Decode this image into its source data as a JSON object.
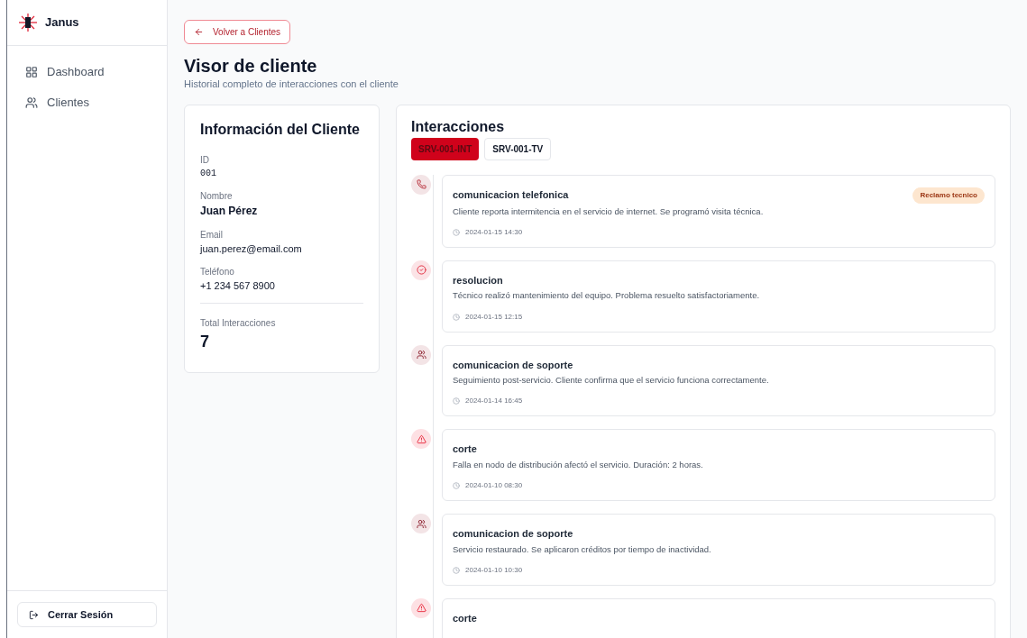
{
  "sidebar": {
    "brand": "Janus",
    "items": [
      {
        "label": "Dashboard",
        "kind": "grid",
        "selected": false
      },
      {
        "label": "Clientes",
        "kind": "users",
        "selected": false
      }
    ],
    "logout": "Cerrar Sesión"
  },
  "header": {
    "back": "Volver a Clientes",
    "title": "Visor de cliente",
    "subtitle": "Historial completo de interacciones con el cliente"
  },
  "client": {
    "title": "Información del Cliente",
    "fields": [
      {
        "label": "ID",
        "value": "001",
        "kind": "mono"
      },
      {
        "label": "Nombre",
        "value": "Juan Pérez",
        "kind": "strong"
      },
      {
        "label": "Email",
        "value": "juan.perez@email.com",
        "kind": "plain"
      },
      {
        "label": "Teléfono",
        "value": "+1 234 567 8900",
        "kind": "plain"
      }
    ],
    "total_label": "Total Interacciones",
    "total": "7"
  },
  "interactions": {
    "title": "Interacciones",
    "tabs": [
      {
        "label": "SRV-001-INT",
        "selected": true
      },
      {
        "label": "SRV-001-TV",
        "selected": false
      }
    ],
    "items": [
      {
        "kind": "phone",
        "title": "comunicacion telefonica",
        "badge": "Reclamo tecnico",
        "text": "Cliente reporta intermitencia en el servicio de internet. Se programó visita técnica.",
        "time": "2024-01-15 14:30"
      },
      {
        "kind": "check",
        "title": "resolucion",
        "text": "Técnico realizó mantenimiento del equipo. Problema resuelto satisfactoriamente.",
        "time": "2024-01-15 12:15"
      },
      {
        "kind": "users",
        "title": "comunicacion de soporte",
        "text": "Seguimiento post-servicio. Cliente confirma que el servicio funciona correctamente.",
        "time": "2024-01-14 16:45"
      },
      {
        "kind": "alert",
        "title": "corte",
        "text": "Falla en nodo de distribución afectó el servicio. Duración: 2 horas.",
        "time": "2024-01-10 08:30"
      },
      {
        "kind": "users",
        "title": "comunicacion de soporte",
        "text": "Servicio restaurado. Se aplicaron créditos por tiempo de inactividad.",
        "time": "2024-01-10 10:30"
      },
      {
        "kind": "alert",
        "title": "corte"
      }
    ]
  }
}
